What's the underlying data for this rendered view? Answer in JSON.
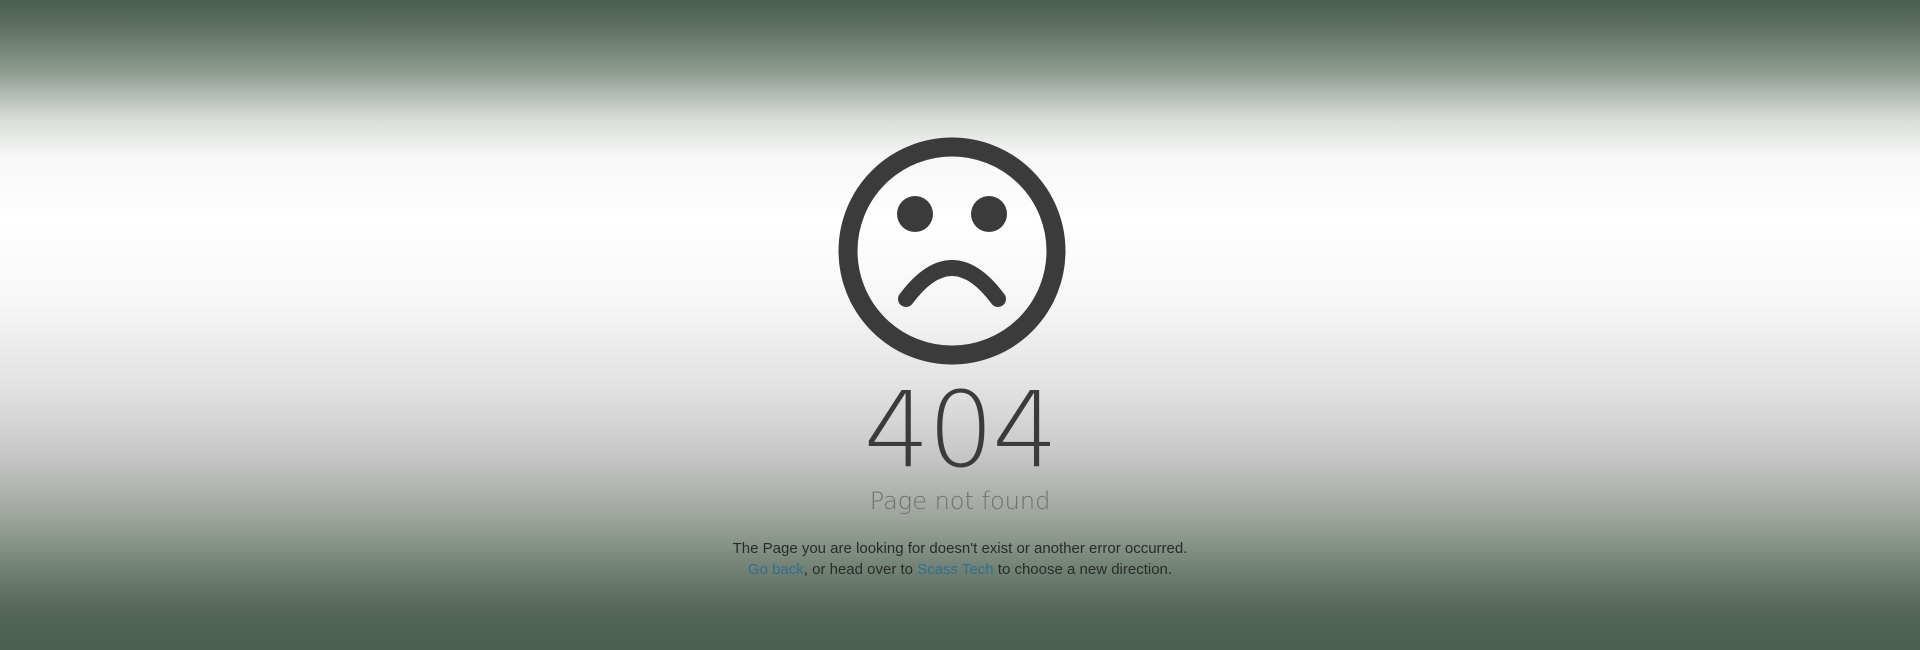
{
  "icon": "sad-face-icon",
  "colors": {
    "icon": "#3b3b3b",
    "link": "#2f6f8f",
    "text": "#2a2a2a",
    "subtitle": "#6f6f6f",
    "background_edge": "#4a5f51"
  },
  "error": {
    "code": "404",
    "title": "Page not found"
  },
  "message": {
    "line1": "The Page you are looking for doesn't exist or another error occurred.",
    "link_back": "Go back",
    "middle": ", or head over to ",
    "link_home": "Scass Tech",
    "end": " to choose a new direction."
  }
}
